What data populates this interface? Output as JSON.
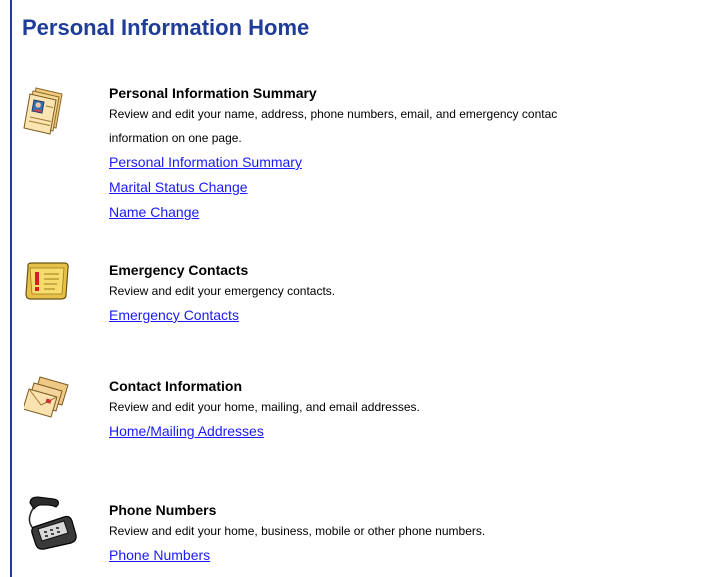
{
  "page": {
    "title": "Personal Information Home"
  },
  "sections": [
    {
      "icon": "personal-info-folder-icon",
      "heading": "Personal Information Summary",
      "description_lines": [
        "Review and edit your name, address, phone numbers, email, and emergency contac",
        "information on one page."
      ],
      "links": [
        "Personal Information Summary",
        "Marital Status Change",
        "Name Change"
      ]
    },
    {
      "icon": "emergency-contact-card-icon",
      "heading": "Emergency Contacts",
      "description_lines": [
        "Review and edit your emergency contacts."
      ],
      "links": [
        "Emergency Contacts"
      ]
    },
    {
      "icon": "envelopes-icon",
      "heading": "Contact Information",
      "description_lines": [
        "Review and edit your home, mailing, and email addresses."
      ],
      "links": [
        "Home/Mailing Addresses"
      ]
    },
    {
      "icon": "telephone-icon",
      "heading": "Phone Numbers",
      "description_lines": [
        "Review and edit your home, business, mobile or other phone numbers."
      ],
      "links": [
        "Phone Numbers"
      ]
    }
  ],
  "colors": {
    "title": "#1f3c99",
    "link": "#1a1aff",
    "rule": "#1f3c99"
  }
}
